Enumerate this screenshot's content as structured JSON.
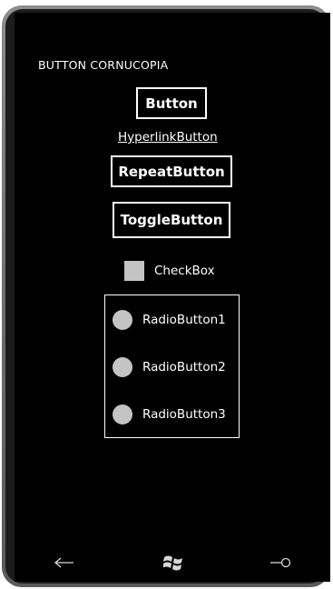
{
  "app": {
    "title": "BUTTON CORNUCOPIA"
  },
  "controls": {
    "button_label": "Button",
    "hyperlink_label": "HyperlinkButton",
    "repeat_button_label": "RepeatButton",
    "toggle_button_label": "ToggleButton",
    "checkbox_label": "CheckBox",
    "checkbox_checked": false
  },
  "radio_group": {
    "items": [
      {
        "label": "RadioButton1",
        "checked": false
      },
      {
        "label": "RadioButton2",
        "checked": false
      },
      {
        "label": "RadioButton3",
        "checked": false
      }
    ]
  },
  "nav_bar": {
    "back_icon": "back-arrow-icon",
    "start_icon": "windows-logo-icon",
    "search_icon": "search-icon"
  },
  "colors": {
    "background": "#000000",
    "foreground": "#ffffff",
    "control_fill": "#c4c4c4"
  }
}
